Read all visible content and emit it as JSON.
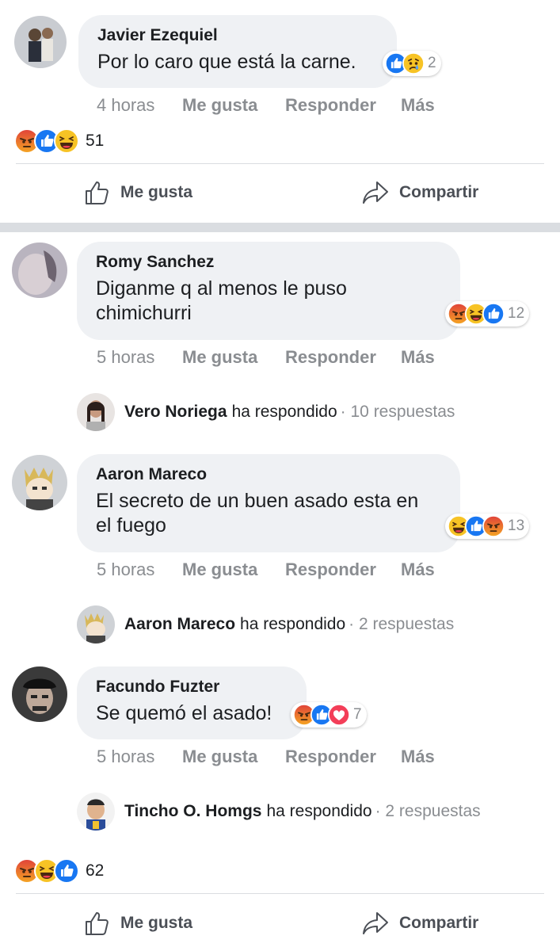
{
  "post1": {
    "comment": {
      "author": "Javier Ezequiel",
      "text": "Por lo caro que está la carne.",
      "reactions": [
        "like",
        "sad"
      ],
      "reaction_count": "2",
      "time": "4 horas",
      "like_label": "Me gusta",
      "reply_label": "Responder",
      "more_label": "Más"
    },
    "summary": {
      "reactions": [
        "angry",
        "like",
        "haha"
      ],
      "count": "51"
    },
    "footer": {
      "like_label": "Me gusta",
      "share_label": "Compartir"
    }
  },
  "post2": {
    "comments": [
      {
        "author": "Romy Sanchez",
        "text": "Diganme q al menos le puso chimichurri",
        "reactions": [
          "angry",
          "haha",
          "like"
        ],
        "reaction_count": "12",
        "time": "5 horas",
        "like_label": "Me gusta",
        "reply_label": "Responder",
        "more_label": "Más",
        "reply": {
          "name": "Vero Noriega",
          "text": "ha respondido",
          "count": "· 10 respuestas"
        }
      },
      {
        "author": "Aaron Mareco",
        "text": "El secreto de un buen asado esta en el fuego",
        "reactions": [
          "haha",
          "like",
          "angry"
        ],
        "reaction_count": "13",
        "time": "5 horas",
        "like_label": "Me gusta",
        "reply_label": "Responder",
        "more_label": "Más",
        "reply": {
          "name": "Aaron Mareco",
          "text": "ha respondido",
          "count": "· 2 respuestas"
        }
      },
      {
        "author": "Facundo Fuzter",
        "text": "Se quemó el asado!",
        "reactions": [
          "angry",
          "like",
          "love"
        ],
        "reaction_count": "7",
        "time": "5 horas",
        "like_label": "Me gusta",
        "reply_label": "Responder",
        "more_label": "Más",
        "reply": {
          "name": "Tincho O. Homgs",
          "text": "ha respondido",
          "count": "· 2 respuestas"
        }
      }
    ],
    "summary": {
      "reactions": [
        "angry",
        "haha",
        "like"
      ],
      "count": "62"
    },
    "footer": {
      "like_label": "Me gusta",
      "share_label": "Compartir"
    }
  },
  "colors": {
    "like": "#1877f2",
    "angry": "#e9710f",
    "haha": "#f7b125",
    "love": "#f33e58",
    "bubble": "#eff1f4",
    "muted": "#8a8d91"
  }
}
